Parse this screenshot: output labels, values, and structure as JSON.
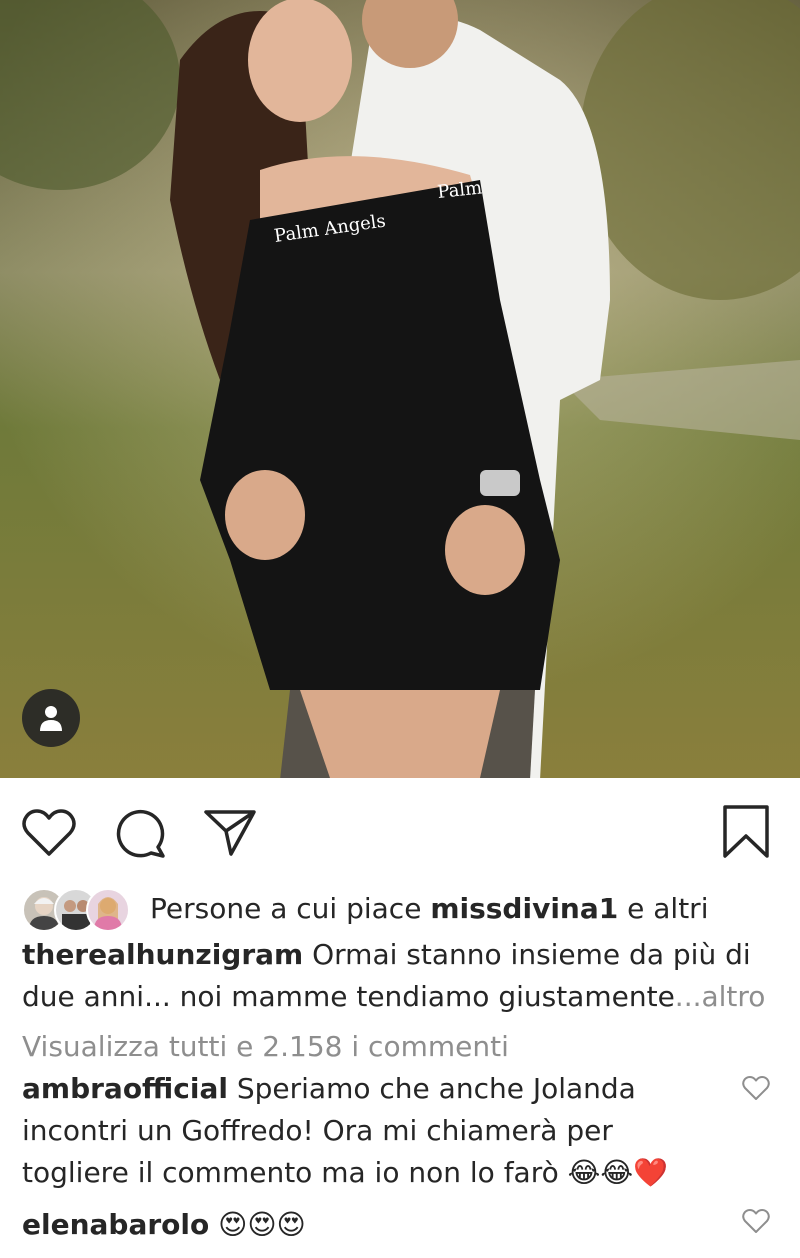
{
  "post": {
    "image_alt": "Couple embracing outdoors, woman in black off-shoulder dress laughing"
  },
  "actions": {
    "like_icon": "heart-outline-icon",
    "comment_icon": "comment-bubble-icon",
    "share_icon": "paper-plane-icon",
    "save_icon": "bookmark-outline-icon"
  },
  "likes": {
    "prefix": "Persone a cui piace ",
    "user": "missdivina1",
    "suffix": " e altri"
  },
  "caption": {
    "username": "therealhunzigram",
    "text": " Ormai stanno insieme da più di due anni... noi mamme tendiamo giustamente",
    "more": "...altro"
  },
  "view_all_comments": "Visualizza tutti e 2.158 i commenti",
  "comments": [
    {
      "username": "ambraofficial",
      "text": " Speriamo che anche Jolanda incontri un Goffredo! Ora mi chiamerà per togliere il commento ma io non lo farò 😂😂❤️"
    },
    {
      "username": "elenabarolo",
      "text": " 😍😍😍"
    }
  ],
  "colors": {
    "text": "#262626",
    "secondary": "#8e8e8e",
    "background": "#ffffff"
  }
}
